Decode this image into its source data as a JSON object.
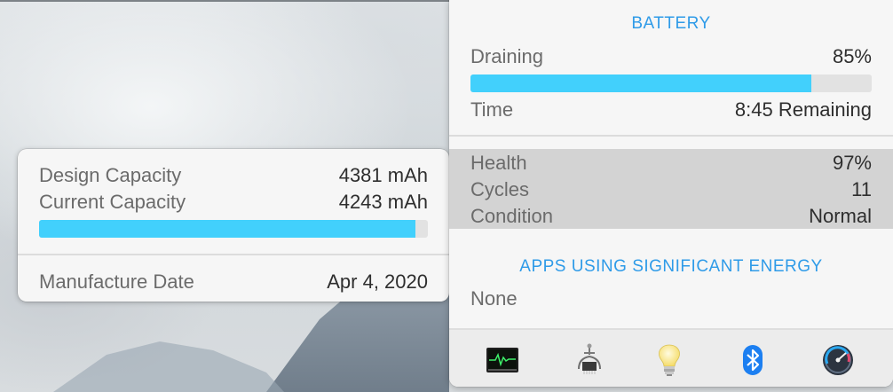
{
  "capacity_popover": {
    "design_capacity_label": "Design Capacity",
    "design_capacity_value": "4381 mAh",
    "current_capacity_label": "Current Capacity",
    "current_capacity_value": "4243 mAh",
    "capacity_fraction": 0.969,
    "manufacture_date_label": "Manufacture Date",
    "manufacture_date_value": "Apr 4, 2020"
  },
  "battery_menu": {
    "title": "BATTERY",
    "status_label": "Draining",
    "charge_value": "85%",
    "charge_fraction": 0.85,
    "time_label": "Time",
    "time_value": "8:45 Remaining",
    "health_label": "Health",
    "health_value": "97%",
    "cycles_label": "Cycles",
    "cycles_value": "11",
    "condition_label": "Condition",
    "condition_value": "Normal",
    "apps_title": "APPS USING SIGNIFICANT ENERGY",
    "apps_value": "None",
    "tools": [
      {
        "name": "activity-monitor-icon"
      },
      {
        "name": "system-information-icon"
      },
      {
        "name": "lightbulb-icon"
      },
      {
        "name": "bluetooth-icon"
      },
      {
        "name": "disk-utility-gauge-icon"
      }
    ]
  },
  "colors": {
    "accent": "#2f9be8",
    "progress_fill": "#42d0fc",
    "progress_track": "#e2e2e2",
    "highlight_row": "#d3d3d3"
  }
}
